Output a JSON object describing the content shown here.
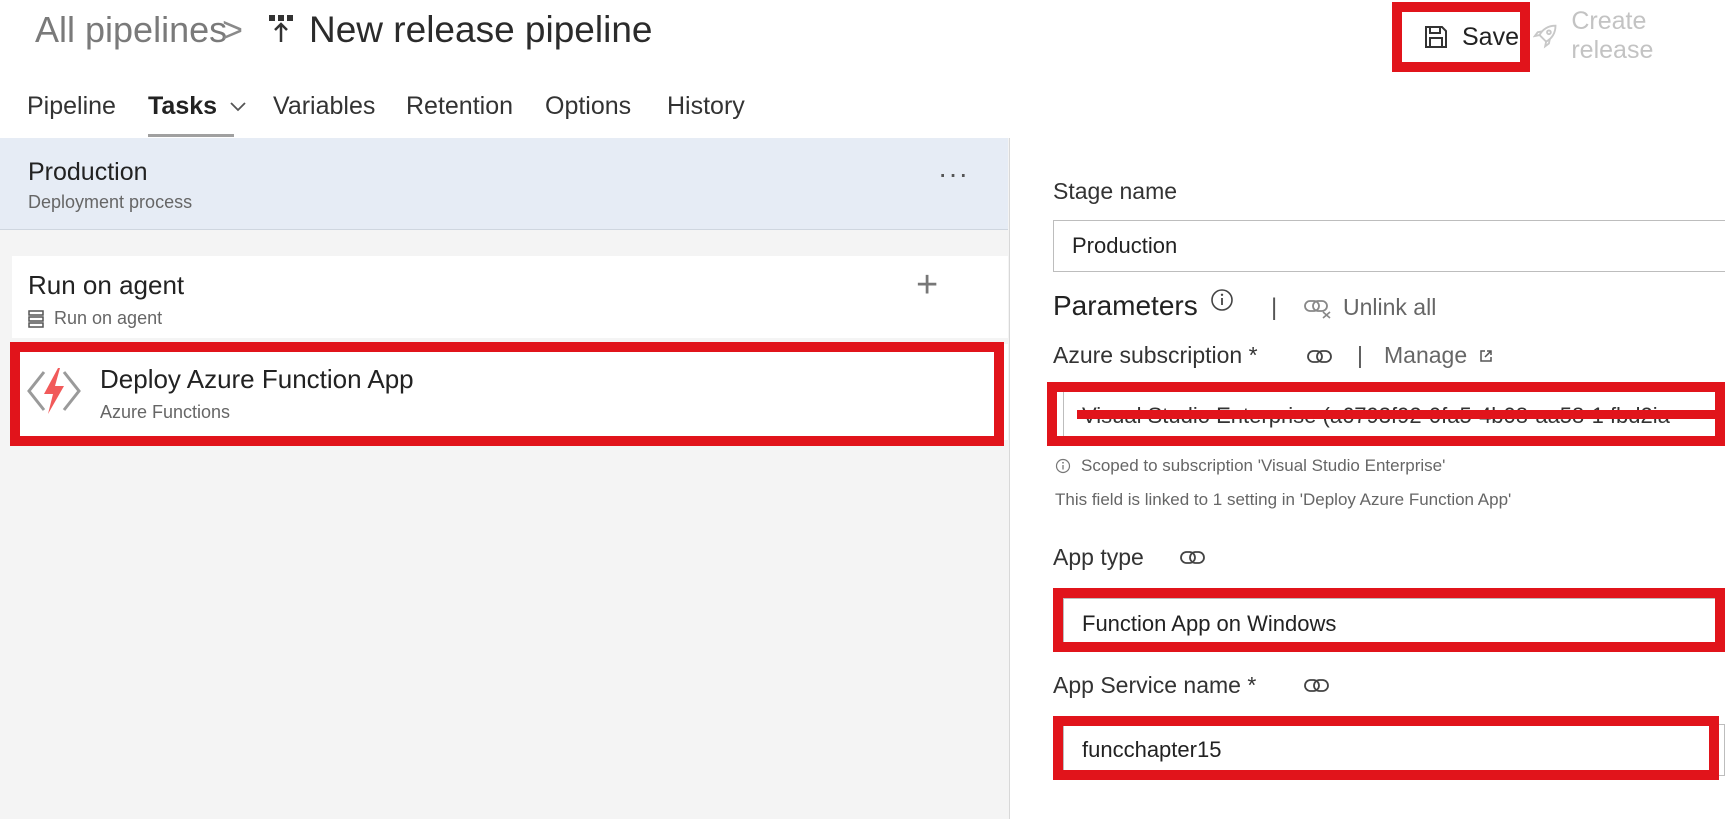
{
  "header": {
    "breadcrumb_root": "All pipelines",
    "breadcrumb_separator": ">",
    "title": "New release pipeline",
    "save_label": "Save",
    "create_release_label": "Create release"
  },
  "tabs": [
    {
      "label": "Pipeline"
    },
    {
      "label": "Tasks"
    },
    {
      "label": "Variables"
    },
    {
      "label": "Retention"
    },
    {
      "label": "Options"
    },
    {
      "label": "History"
    }
  ],
  "active_tab": "Tasks",
  "stage": {
    "name": "Production",
    "subtitle": "Deployment process",
    "more": "···"
  },
  "agent_job": {
    "title": "Run on agent",
    "subtitle": "Run on agent",
    "add": "+"
  },
  "task": {
    "title": "Deploy Azure Function App",
    "subtitle": "Azure Functions"
  },
  "form": {
    "stage_name_label": "Stage name",
    "stage_name_value": "Production",
    "parameters_title": "Parameters",
    "separator": "|",
    "unlink_all": "Unlink all",
    "azure_subscription_label": "Azure subscription *",
    "manage_label": "Manage",
    "azure_subscription_value": "Visual Studio Enterprise (a6793f92-0fa5-4b08-aa58-1 fbd2ia",
    "scope_note": "Scoped to subscription 'Visual Studio Enterprise'",
    "linked_note": "This field is linked to 1 setting in 'Deploy Azure Function App'",
    "app_type_label": "App type",
    "app_type_value": "Function App on Windows",
    "app_service_name_label": "App Service name *",
    "app_service_name_value": "funcchapter15"
  },
  "colors": {
    "highlight_red": "#e1141b",
    "stage_header_bg": "#e6ecf5",
    "function_bolt": "#f15a5a"
  }
}
